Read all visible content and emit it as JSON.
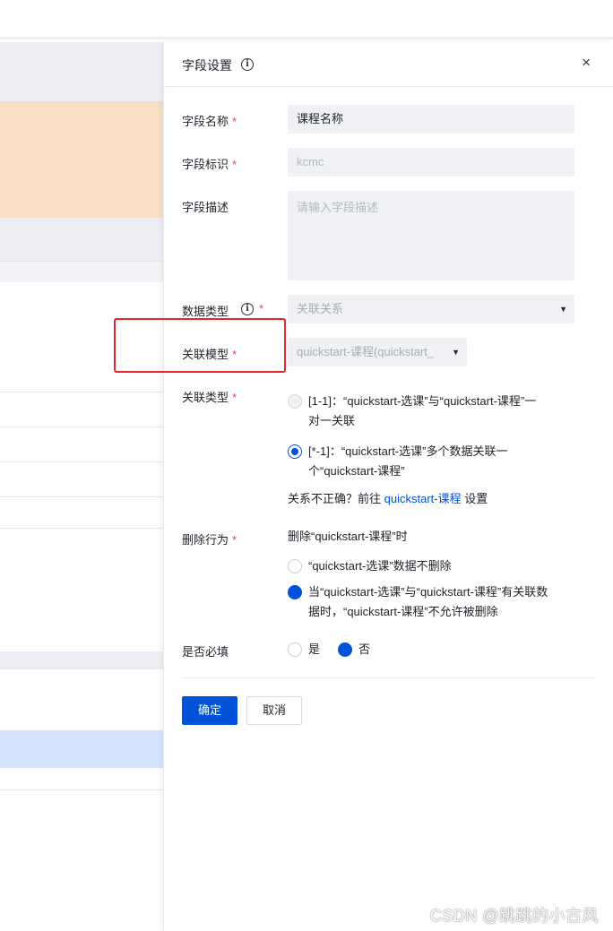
{
  "drawer": {
    "title": "字段设置",
    "close": "×"
  },
  "fields": {
    "name": {
      "label": "字段名称",
      "required": "*",
      "value": "课程名称"
    },
    "identifier": {
      "label": "字段标识",
      "required": "*",
      "value": "kcmc"
    },
    "description": {
      "label": "字段描述",
      "placeholder": "请输入字段描述"
    },
    "data_type": {
      "label": "数据类型",
      "required": "*",
      "value": "关联关系"
    },
    "related_model": {
      "label": "关联模型",
      "required": "*",
      "value": "quickstart-课程(quickstart_"
    },
    "relation_type": {
      "label": "关联类型",
      "required": "*",
      "options": [
        {
          "line1": "[1-1]：“quickstart-选课”与“quickstart-课程”一",
          "line2": "对一关联"
        },
        {
          "line1": "[*-1]：“quickstart-选课”多个数据关联一",
          "line2": "个“quickstart-课程”"
        }
      ],
      "hint_prefix": "关系不正确？前往",
      "hint_link": "quickstart-课程",
      "hint_suffix": "设置"
    },
    "delete_behavior": {
      "label": "删除行为",
      "required": "*",
      "desc": "删除“quickstart-课程”时",
      "options": [
        {
          "line1": "“quickstart-选课”数据不删除"
        },
        {
          "line1": "当“quickstart-选课”与“quickstart-课程”有关联数",
          "line2": "据时，“quickstart-课程”不允许被删除"
        }
      ]
    },
    "required_field": {
      "label": "是否必填",
      "options": [
        "是",
        "否"
      ]
    }
  },
  "buttons": {
    "confirm": "确定",
    "cancel": "取消"
  },
  "watermark": "CSDN @跳跳的小古风",
  "colors": {
    "primary": "#0052d9",
    "required": "#e54545",
    "highlight_box": "#e8262b",
    "bg_orange": "#f8dfc4",
    "bg_blue": "#d6e4fb"
  }
}
